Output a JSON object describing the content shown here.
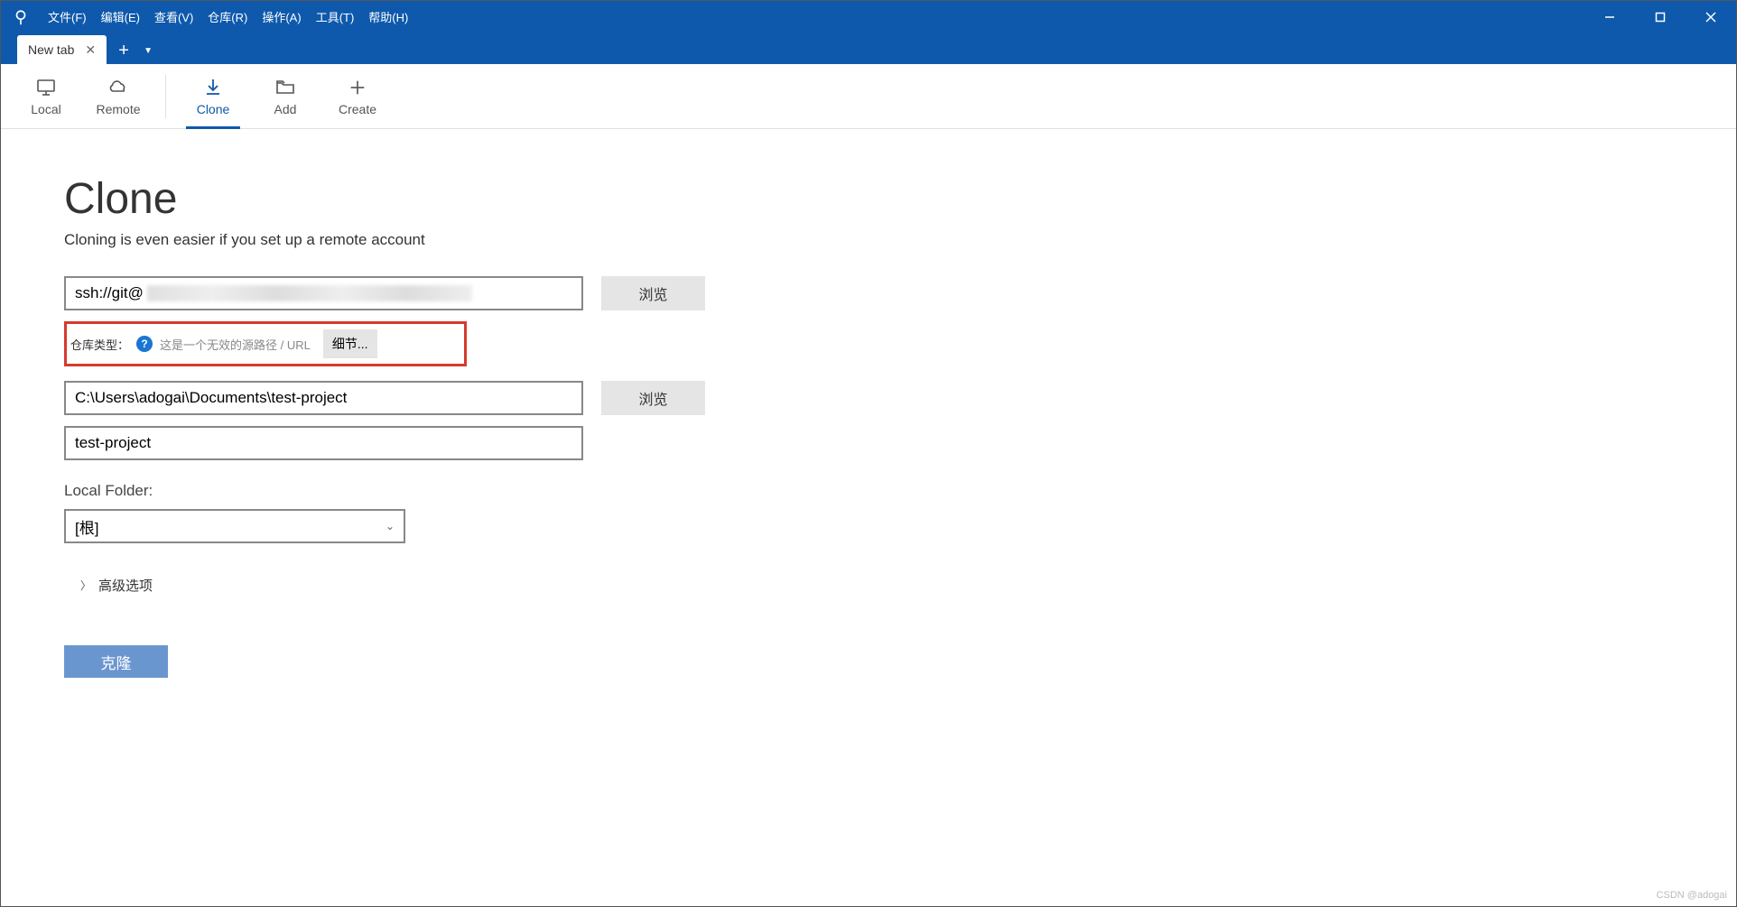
{
  "menubar": {
    "items": [
      "文件(F)",
      "编辑(E)",
      "查看(V)",
      "仓库(R)",
      "操作(A)",
      "工具(T)",
      "帮助(H)"
    ]
  },
  "tabs": {
    "active": "New tab"
  },
  "toolbar": {
    "local": "Local",
    "remote": "Remote",
    "clone": "Clone",
    "add": "Add",
    "create": "Create"
  },
  "page": {
    "title": "Clone",
    "subtitle_prefix": "Cloning is even easier if you set up a ",
    "subtitle_link": "remote account"
  },
  "form": {
    "source_url_prefix": "ssh://git@",
    "browse1": "浏览",
    "repo_type_label": "仓库类型：",
    "repo_type_msg": "这是一个无效的源路径 / URL",
    "details_btn": "细节...",
    "dest_path": "C:\\Users\\adogai\\Documents\\test-project",
    "browse2": "浏览",
    "name": "test-project",
    "local_folder_label": "Local Folder:",
    "local_folder_value": "[根]",
    "advanced": "高级选项",
    "clone_btn": "克隆"
  },
  "watermark": "CSDN @adogai"
}
